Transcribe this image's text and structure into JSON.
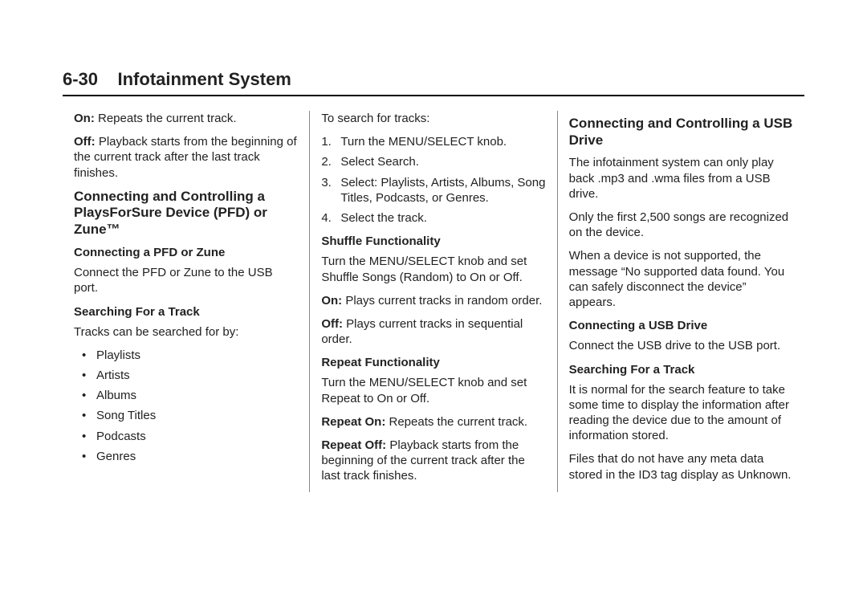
{
  "header": {
    "page_number": "6-30",
    "title": "Infotainment System"
  },
  "col1": {
    "p1_lead": "On:",
    "p1_rest": "  Repeats the current track.",
    "p2_lead": "Off:",
    "p2_rest": "  Playback starts from the beginning of the current track after the last track finishes.",
    "h2a": "Connecting and Controlling a PlaysForSure Device (PFD) or Zune™",
    "h3a": "Connecting a PFD or Zune",
    "p3": "Connect the PFD or Zune to the USB port.",
    "h3b": "Searching For a Track",
    "p4": "Tracks can be searched for by:",
    "bullets": [
      "Playlists",
      "Artists",
      "Albums",
      "Song Titles",
      "Podcasts",
      "Genres"
    ]
  },
  "col2": {
    "p1": "To search for tracks:",
    "steps": [
      "Turn the MENU/SELECT knob.",
      "Select Search.",
      "Select: Playlists, Artists, Albums, Song Titles, Podcasts, or Genres.",
      "Select the track."
    ],
    "h3a": "Shuffle Functionality",
    "p2": "Turn the MENU/SELECT knob and set Shuffle Songs (Random) to On or Off.",
    "p3_lead": "On:",
    "p3_rest": "  Plays current tracks in random order.",
    "p4_lead": "Off:",
    "p4_rest": "  Plays current tracks in sequential order.",
    "h3b": "Repeat Functionality",
    "p5": "Turn the MENU/SELECT knob and set Repeat to On or Off.",
    "p6_lead": "Repeat On:",
    "p6_rest": "  Repeats the current track.",
    "p7_lead": "Repeat Off:",
    "p7_rest": "  Playback starts from the beginning of the current track after the last track finishes."
  },
  "col3": {
    "h2a": "Connecting and Controlling a USB Drive",
    "p1": "The infotainment system can only play back .mp3 and .wma files from a USB drive.",
    "p2": "Only the first 2,500 songs are recognized on the device.",
    "p3": "When a device is not supported, the message “No supported data found. You can safely disconnect the device” appears.",
    "h3a": "Connecting a USB Drive",
    "p4": "Connect the USB drive to the USB port.",
    "h3b": "Searching For a Track",
    "p5": "It is normal for the search feature to take some time to display the information after reading the device due to the amount of information stored.",
    "p6": "Files that do not have any meta data stored in the ID3 tag display as Unknown."
  }
}
